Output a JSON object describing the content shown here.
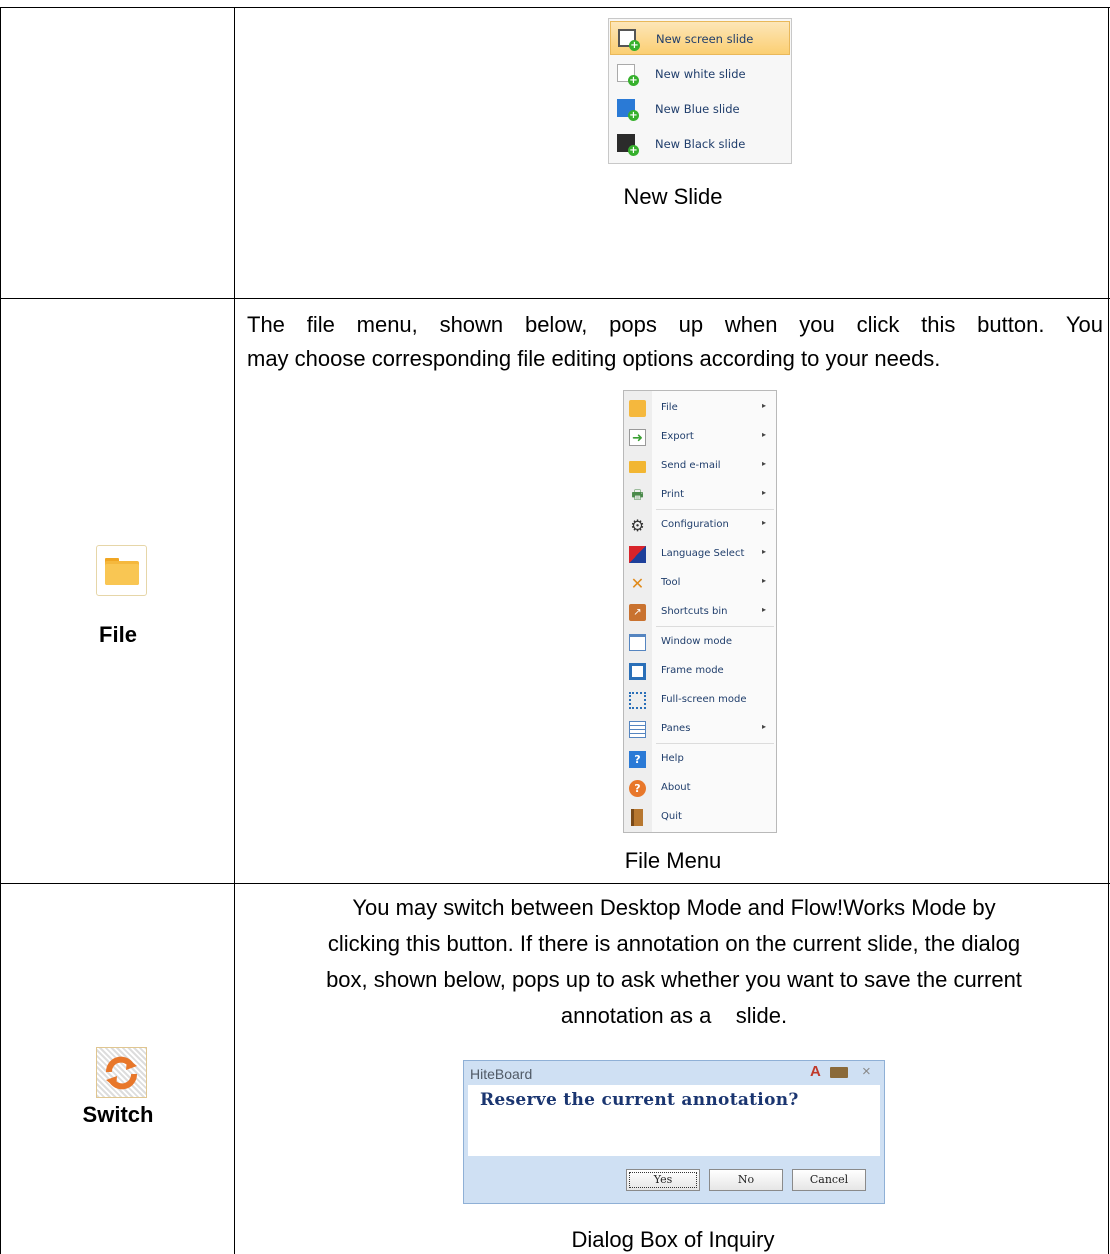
{
  "row1": {
    "slide_menu": {
      "items": [
        {
          "label": "New screen slide",
          "icon": "screen-slide-icon",
          "highlighted": true
        },
        {
          "label": "New white slide",
          "icon": "white-slide-icon",
          "highlighted": false
        },
        {
          "label": "New Blue slide",
          "icon": "blue-slide-icon",
          "highlighted": false
        },
        {
          "label": "New Black slide",
          "icon": "black-slide-icon",
          "highlighted": false
        }
      ]
    },
    "caption": "New Slide"
  },
  "row2": {
    "label": "File",
    "icon": "folder-icon",
    "description_line1": "The file menu, shown below, pops up when you click this button. You",
    "description_line2": "may choose corresponding file editing options according to your needs.",
    "file_menu": {
      "items": [
        {
          "label": "File",
          "icon": "folder-icon",
          "submenu": true
        },
        {
          "label": "Export",
          "icon": "export-icon",
          "submenu": true
        },
        {
          "label": "Send e-mail",
          "icon": "envelope-icon",
          "submenu": true
        },
        {
          "label": "Print",
          "icon": "printer-icon",
          "submenu": true
        },
        {
          "label": "Configuration",
          "icon": "gear-icon",
          "submenu": true
        },
        {
          "label": "Language Select",
          "icon": "flag-icon",
          "submenu": true
        },
        {
          "label": "Tool",
          "icon": "tools-icon",
          "submenu": true
        },
        {
          "label": "Shortcuts bin",
          "icon": "shortcut-icon",
          "submenu": true
        },
        {
          "label": "Window mode",
          "icon": "window-icon",
          "submenu": false
        },
        {
          "label": "Frame mode",
          "icon": "frame-icon",
          "submenu": false
        },
        {
          "label": "Full-screen mode",
          "icon": "fullscreen-icon",
          "submenu": false
        },
        {
          "label": "Panes",
          "icon": "panes-icon",
          "submenu": true
        },
        {
          "label": "Help",
          "icon": "help-icon",
          "submenu": false
        },
        {
          "label": "About",
          "icon": "about-icon",
          "submenu": false
        },
        {
          "label": "Quit",
          "icon": "quit-door-icon",
          "submenu": false
        }
      ],
      "arrow_glyph": "▸"
    },
    "caption": "File Menu"
  },
  "row3": {
    "label": "Switch",
    "icon": "switch-refresh-icon",
    "description_lines": [
      "You may switch between Desktop Mode and Flow!Works Mode by",
      "clicking this button. If there is annotation on the current slide, the dialog",
      "box, shown below, pops up to ask whether you want to save the current",
      "annotation as a    slide."
    ],
    "dialog": {
      "title": "HiteBoard",
      "message": "Reserve the current annotation?",
      "close_glyph": "×",
      "buttons": {
        "yes": "Yes",
        "no": "No",
        "cancel": "Cancel"
      }
    },
    "caption": "Dialog Box of Inquiry"
  },
  "colors": {
    "highlight": "#fbcf73",
    "dialog_frame": "#cfe0f3",
    "menu_text": "#1f3d6b",
    "dialog_text": "#1a3570",
    "folder": "#f5b83d"
  }
}
